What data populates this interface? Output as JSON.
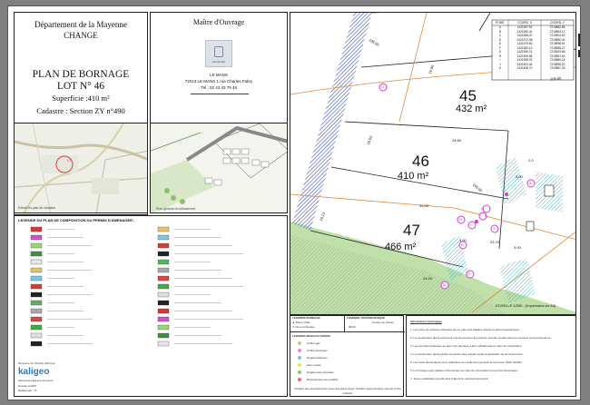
{
  "title_block": {
    "department": "Département de la Mayenne",
    "commune": "CHANGE",
    "plan_title": "PLAN DE BORNAGE",
    "lot_label": "LOT N° 46",
    "area_label": "Superficie :410 m²",
    "cadastre_label": "Cadastre : Section ZY n°490"
  },
  "owner_block": {
    "heading": "Maître d'Ouvrage",
    "logo_text": "LELIEVRE",
    "city": "LE MANS",
    "address": "72013 LE MANS 1 rue Charles Fabry",
    "phone": "Tél : 02 43 43 79 46"
  },
  "vicinity_map": {
    "caption": "Extrait du plan de situation",
    "marker": "LT"
  },
  "site_plan": {
    "caption": "Plan général du lotissement"
  },
  "legend_panel": {
    "title": "LEGENDE DU PLAN DE COMPOSITION DU PERMIS D'AMENAGER :",
    "date_text": "Dressé le 11 Octobre 2024 par",
    "company": "kaligeo",
    "company_sub": "Géomètres-Experts Fonciers",
    "dossier": "Dossier 2-0967",
    "author": "Réalisé par : IS"
  },
  "main_plan": {
    "lots": [
      {
        "number": "45",
        "area": "432 m²"
      },
      {
        "number": "46",
        "area": "410 m²"
      },
      {
        "number": "47",
        "area": "466 m²"
      }
    ],
    "dimensions": [
      "105.00",
      "105.50",
      "16.90",
      "15.53",
      "24.60",
      "24.00",
      "16.13",
      "24.00",
      "105.00",
      "23.70",
      "3.00",
      "3.00",
      "3.00",
      "2.0"
    ],
    "markers": [
      "C",
      "G",
      "H",
      "I",
      "J",
      "K",
      "E",
      "F",
      "D",
      "A"
    ],
    "coord_table": {
      "header": [
        "POINT",
        "COORD. X",
        "COORD. Y"
      ],
      "rows": [
        [
          "A",
          "1421557.91",
          "7219882.56"
        ],
        [
          "B",
          "1421560.30",
          "7219893.12"
        ],
        [
          "C",
          "1421558.47",
          "7219904.83"
        ],
        [
          "D",
          "1421572.08",
          "7219890.40"
        ],
        [
          "E",
          "1421575.60",
          "7219898.91"
        ],
        [
          "F",
          "1421582.13",
          "7219885.27"
        ],
        [
          "G",
          "1421590.74",
          "7219903.66"
        ],
        [
          "H",
          "1421593.55",
          "7219891.50"
        ],
        [
          "I",
          "1421595.02",
          "7219880.18"
        ],
        [
          "J",
          "1421601.44",
          "7219896.20"
        ],
        [
          "K",
          "1421608.70",
          "7219887.33"
        ]
      ]
    },
    "scale_text": "ECHELLE 1/250 - (Impression en A3)",
    "recap_label": "RECAP",
    "sheet_heading": "LEGENDE BORNAGE",
    "topo_heading": "LEGENDE TOPOGRAPHIQUE"
  },
  "bottom_legend": {
    "legend_items": [
      {
        "symbol": "triangle",
        "label": "Borne OGE"
      },
      {
        "symbol": "cross",
        "label": "Clou ou Marque"
      }
    ],
    "topo_items": [
      "Courbe de niveau",
      "du terrain naturel avant travaux"
    ],
    "topo_value": "98.00",
    "network_title": "LEGENDE RESEAUX DIVERS",
    "network_items": [
      {
        "color": "#e4c07a",
        "label": "Coffret gaz"
      },
      {
        "color": "#e08fd9",
        "label": "Coffret électrique"
      },
      {
        "color": "#79c2e0",
        "label": "Regard télécoms"
      },
      {
        "color": "#e8e350",
        "label": "Eaux usées"
      },
      {
        "color": "#6fd37e",
        "label": "Regard eaux pluviales"
      },
      {
        "color": "#ef6b6b",
        "label": "Branchement eau potable"
      }
    ],
    "footer_note": "Position des branchements issue des plans projet. Position approximative donnée à titre indicatif.",
    "notes_heading": "Informations techniques",
    "notes": [
      "1. Les cotes de surfaces indiquées sur ce plan sont établies d'après le plan topographique.",
      "2. Le constructeur devra avant tout commencement des travaux prendre contact avec les services concessionnaires.",
      "3. Les emprises indiquées au plan sont données à titre indicatif selon le plan de composition.",
      "4. Le constructeur devra vérifier la position des réseaux avant implantation de sa construction.",
      "5. Les cotes altimétriques sont rattachées au nivellement général de la France (NGF-IGN69).",
      "6. Le bornage a été réalisé conformément au plan de composition du permis d'aménager.",
      "7. Toute modification du plan fera l'objet d'un nouveau document."
    ]
  }
}
